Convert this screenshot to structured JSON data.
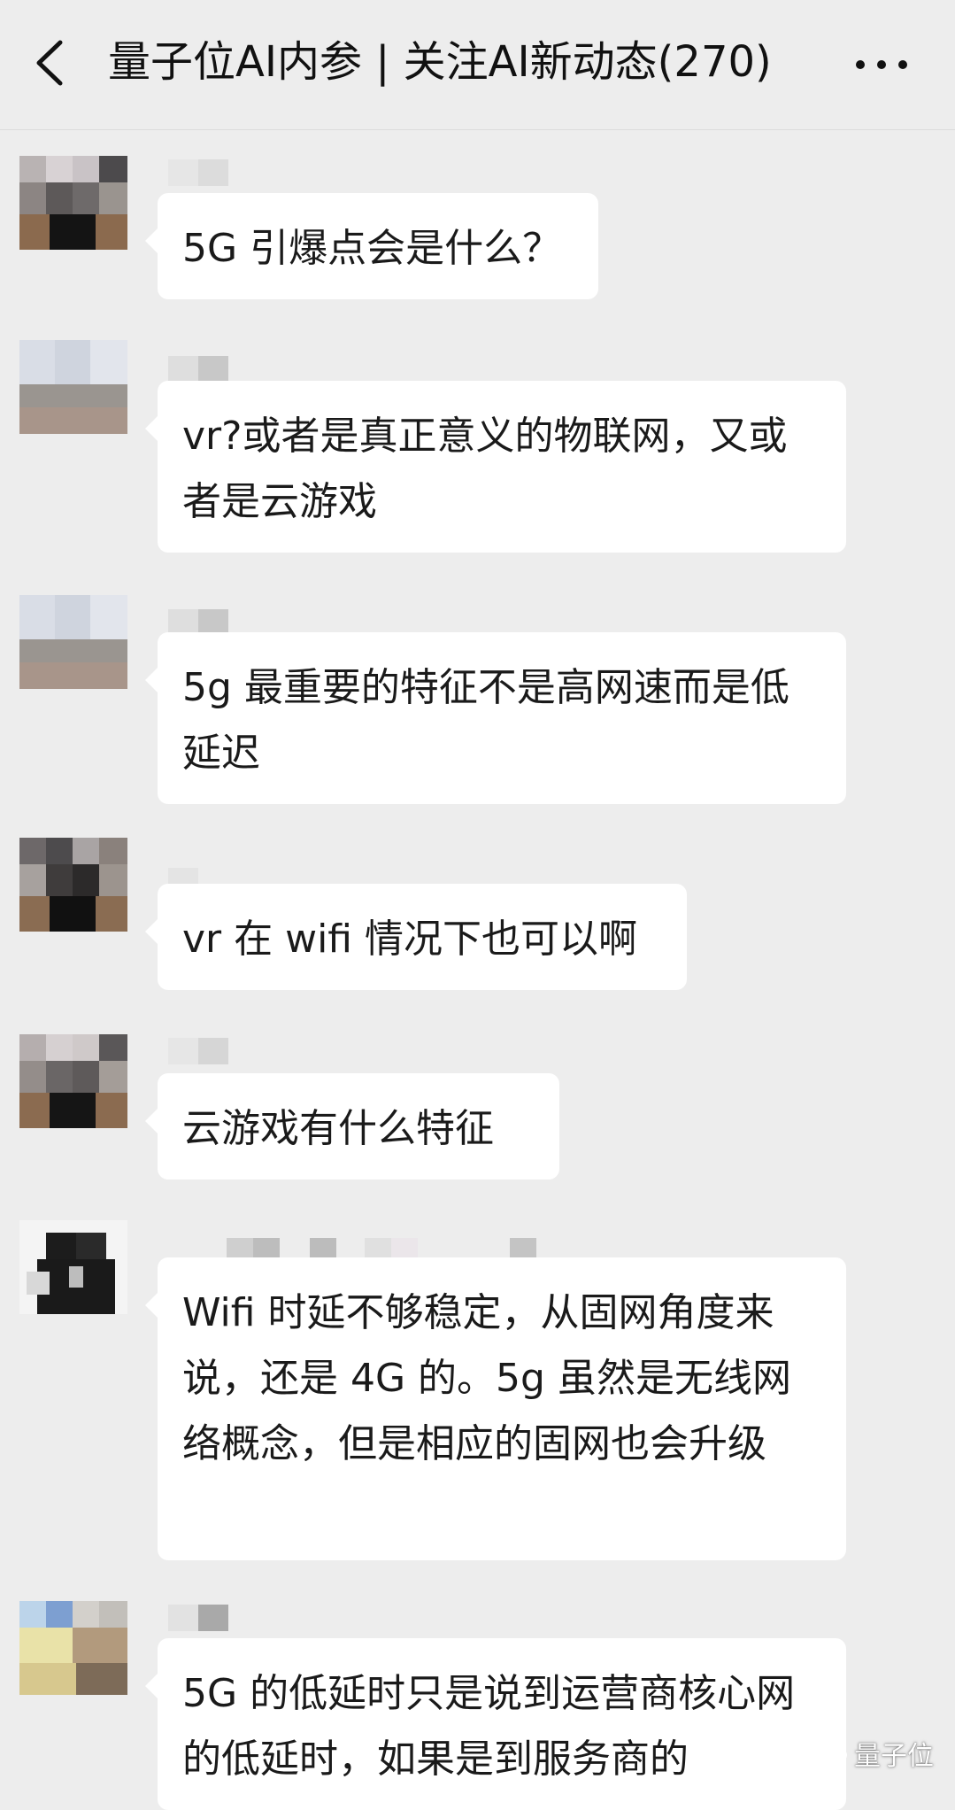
{
  "header": {
    "title": "量子位AI内参 | 关注AI新动态(270)"
  },
  "messages": [
    {
      "text": "5G 引爆点会是什么？"
    },
    {
      "text": "vr?或者是真正意义的物联网，又或者是云游戏"
    },
    {
      "text": "5g 最重要的特征不是高网速而是低延迟"
    },
    {
      "text": "vr 在 wifi 情况下也可以啊"
    },
    {
      "text": "云游戏有什么特征"
    },
    {
      "text": "Wifi 时延不够稳定，从固网角度来说，还是 4G 的。5g 虽然是无线网络概念，但是相应的固网也会升级"
    },
    {
      "text": "5G 的低延时只是说到运营商核心网的低延时，如果是到服务商的"
    }
  ],
  "watermark": {
    "text": "量子位"
  },
  "colors": {
    "background": "#ededed",
    "bubble": "#ffffff",
    "text": "#1a1a1a"
  }
}
